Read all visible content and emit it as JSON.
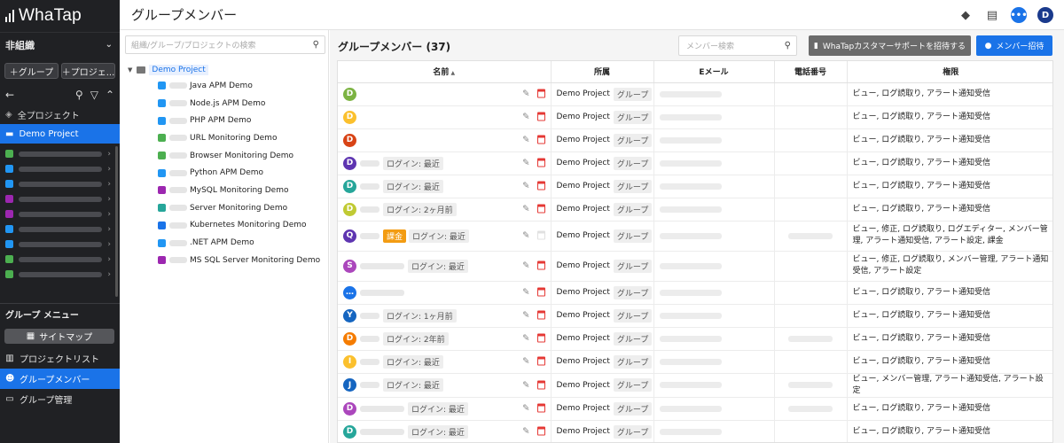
{
  "sidebar": {
    "logo_text": "WhaTap",
    "org_label": "非組織",
    "add_group": "グループ",
    "add_project": "プロジェ...",
    "all_projects": "全プロジェクト",
    "active_project": "Demo Project",
    "project_icon_colors": [
      "#4caf50",
      "#2196f3",
      "#2196f3",
      "#9c27b0",
      "#9c27b0",
      "#2196f3",
      "#2196f3",
      "#4caf50",
      "#4caf50"
    ],
    "group_menu_title": "グループ メニュー",
    "sitemap_label": "サイトマップ",
    "menu": [
      {
        "label": "プロジェクトリスト",
        "icon": "chart-icon"
      },
      {
        "label": "グループメンバー",
        "icon": "people-icon",
        "active": true
      },
      {
        "label": "グループ管理",
        "icon": "folder-gear-icon"
      }
    ]
  },
  "header": {
    "title": "グループメンバー",
    "user_initial": "D"
  },
  "tree": {
    "search_placeholder": "組織/グループ/プロジェクトの検索",
    "root_label": "Demo Project",
    "items": [
      {
        "label": "Java APM Demo",
        "color": "#2196f3"
      },
      {
        "label": "Node.js APM Demo",
        "color": "#2196f3"
      },
      {
        "label": "PHP APM Demo",
        "color": "#2196f3"
      },
      {
        "label": "URL Monitoring Demo",
        "color": "#4caf50"
      },
      {
        "label": "Browser Monitoring Demo",
        "color": "#4caf50"
      },
      {
        "label": "Python APM Demo",
        "color": "#2196f3"
      },
      {
        "label": "MySQL Monitoring Demo",
        "color": "#9c27b0"
      },
      {
        "label": "Server Monitoring Demo",
        "color": "#26a69a"
      },
      {
        "label": "Kubernetes Monitoring Demo",
        "color": "#1a73e8"
      },
      {
        "label": ".NET APM Demo",
        "color": "#2196f3"
      },
      {
        "label": "MS SQL Server Monitoring Demo",
        "color": "#9c27b0"
      }
    ]
  },
  "main": {
    "title": "グループメンバー (37)",
    "member_search_placeholder": "メンバー検索",
    "invite_support_label": "WhaTapカスタマーサポートを招待する",
    "invite_member_label": "メンバー招待",
    "columns": {
      "name": "名前",
      "dept": "所属",
      "email": "Eメール",
      "phone": "電話番号",
      "perm": "権限"
    },
    "rows": [
      {
        "initial": "D",
        "color": "#7cb342",
        "status": "",
        "dept": "Demo Project",
        "chip": "グループ",
        "perm": "ビュー, ログ読取り, アラート通知受信"
      },
      {
        "initial": "D",
        "color": "#fbc02d",
        "status": "",
        "dept": "Demo Project",
        "chip": "グループ",
        "perm": "ビュー, ログ読取り, アラート通知受信"
      },
      {
        "initial": "D",
        "color": "#d84315",
        "status": "",
        "dept": "Demo Project",
        "chip": "グループ",
        "perm": "ビュー, ログ読取り, アラート通知受信"
      },
      {
        "initial": "D",
        "color": "#5e35b1",
        "status": "ログイン: 最近",
        "dept": "Demo Project",
        "chip": "グループ",
        "perm": "ビュー, ログ読取り, アラート通知受信"
      },
      {
        "initial": "D",
        "color": "#26a69a",
        "status": "ログイン: 最近",
        "dept": "Demo Project",
        "chip": "グループ",
        "perm": "ビュー, ログ読取り, アラート通知受信"
      },
      {
        "initial": "D",
        "color": "#c0ca33",
        "status": "ログイン: 2ヶ月前",
        "dept": "Demo Project",
        "chip": "グループ",
        "perm": "ビュー, ログ読取り, アラート通知受信"
      },
      {
        "initial": "Q",
        "color": "#5e35b1",
        "badge": "課金",
        "status": "ログイン: 最近",
        "dept": "Demo Project",
        "chip": "グループ",
        "perm": "ビュー, 修正, ログ読取り, ログエディター, メンバー管理, アラート通知受信, アラート設定, 課金",
        "tall": true,
        "del_disabled": true
      },
      {
        "initial": "S",
        "color": "#ab47bc",
        "status": "ログイン: 最近",
        "dept": "Demo Project",
        "chip": "グループ",
        "perm": "ビュー, 修正, ログ読取り, メンバー管理, アラート通知受信, アラート設定",
        "tall": true,
        "wide_blur": true
      },
      {
        "initial": "…",
        "color": "#1a73e8",
        "status": "",
        "dept": "Demo Project",
        "chip": "グループ",
        "perm": "ビュー, ログ読取り, アラート通知受信",
        "wide_blur": true
      },
      {
        "initial": "Y",
        "color": "#1565c0",
        "status": "ログイン: 1ヶ月前",
        "dept": "Demo Project",
        "chip": "グループ",
        "perm": "ビュー, ログ読取り, アラート通知受信"
      },
      {
        "initial": "D",
        "color": "#f57c00",
        "status": "ログイン: 2年前",
        "dept": "Demo Project",
        "chip": "グループ",
        "perm": "ビュー, ログ読取り, アラート通知受信"
      },
      {
        "initial": "I",
        "color": "#fbc02d",
        "status": "ログイン: 最近",
        "dept": "Demo Project",
        "chip": "グループ",
        "perm": "ビュー, ログ読取り, アラート通知受信"
      },
      {
        "initial": "J",
        "color": "#1565c0",
        "status": "ログイン: 最近",
        "dept": "Demo Project",
        "chip": "グループ",
        "perm": "ビュー, メンバー管理, アラート通知受信, アラート設定"
      },
      {
        "initial": "D",
        "color": "#ab47bc",
        "status": "ログイン: 最近",
        "dept": "Demo Project",
        "chip": "グループ",
        "perm": "ビュー, ログ読取り, アラート通知受信",
        "wide_blur": true
      },
      {
        "initial": "D",
        "color": "#26a69a",
        "status": "ログイン: 最近",
        "dept": "Demo Project",
        "chip": "グループ",
        "perm": "ビュー, ログ読取り, アラート通知受信",
        "wide_blur": true
      }
    ]
  }
}
